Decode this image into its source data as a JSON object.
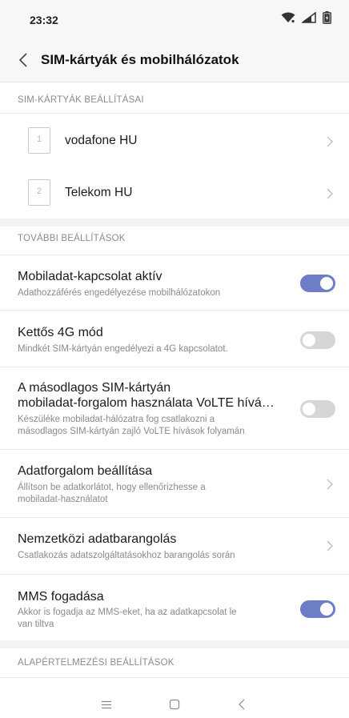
{
  "status_bar": {
    "time": "23:32",
    "icons": [
      "wifi-icon",
      "signal-icon",
      "battery-icon"
    ]
  },
  "header": {
    "back_icon": "chevron-left-icon",
    "title": "SIM-kártyák és mobilhálózatok"
  },
  "sim_section": {
    "label": "SIM-KÁRTYÁK BEÁLLÍTÁSAI",
    "cards": [
      {
        "slot": "1",
        "name": "vodafone HU"
      },
      {
        "slot": "2",
        "name": "Telekom HU"
      }
    ]
  },
  "more_section": {
    "label": "TOVÁBBI BEÁLLÍTÁSOK",
    "items": [
      {
        "title": "Mobiladat-kapcsolat aktív",
        "subtitle": "Adathozzáférés engedélyezése mobilhálózatokon",
        "control": "toggle",
        "enabled": true
      },
      {
        "title": "Kettős 4G mód",
        "subtitle": "Mindkét SIM-kártyán engedélyezi a 4G kapcsolatot.",
        "control": "toggle",
        "enabled": false
      },
      {
        "title_line1": "A másodlagos SIM-kártyán",
        "title_line2": "mobiladat-forgalom használata VoLTE hívá…",
        "subtitle_line1": "Készüléke mobiladat-hálózatra fog csatlakozni a",
        "subtitle_line2": "másodlagos SIM-kártyán zajló VoLTE hívások folyamán",
        "control": "toggle",
        "enabled": false
      },
      {
        "title": "Adatforgalom beállítása",
        "subtitle_line1": "Állítson be adatkorlátot, hogy ellenőrizhesse a",
        "subtitle_line2": "mobiladat-használatot",
        "control": "chevron"
      },
      {
        "title": "Nemzetközi adatbarangolás",
        "subtitle": "Csatlakozás adatszolgáltatásokhoz barangolás során",
        "control": "chevron"
      },
      {
        "title": "MMS fogadása",
        "subtitle_line1": "Akkor is fogadja az MMS-eket, ha az adatkapcsolat le",
        "subtitle_line2": "van tiltva",
        "control": "toggle",
        "enabled": true
      }
    ]
  },
  "default_section": {
    "label": "ALAPÉRTELMEZÉSI BEÁLLÍTÁSOK"
  },
  "nav_bar": {
    "icons": [
      "menu-icon",
      "home-icon",
      "back-icon"
    ]
  },
  "colors": {
    "toggle_on": "#6d7ec6",
    "toggle_off": "#d6d6d6",
    "section_text": "#8b8b8b"
  }
}
